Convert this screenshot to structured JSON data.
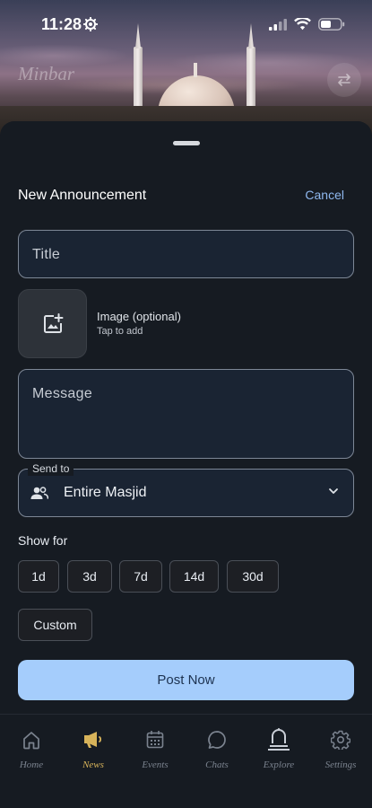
{
  "status_bar": {
    "time": "11:28"
  },
  "header": {
    "brand": "Minbar"
  },
  "sheet": {
    "title": "New Announcement",
    "cancel_label": "Cancel",
    "title_placeholder": "Title",
    "image": {
      "label": "Image (optional)",
      "hint": "Tap to add"
    },
    "message_placeholder": "Message",
    "send_to": {
      "legend": "Send to",
      "value": "Entire Masjid"
    },
    "show_for": {
      "label": "Show for",
      "options": [
        "1d",
        "3d",
        "7d",
        "14d",
        "30d",
        "Custom"
      ]
    },
    "post_label": "Post Now"
  },
  "tabs": [
    {
      "label": "Home",
      "icon": "home-icon"
    },
    {
      "label": "News",
      "icon": "megaphone-icon",
      "active": true
    },
    {
      "label": "Events",
      "icon": "calendar-icon"
    },
    {
      "label": "Chats",
      "icon": "chat-bubble-icon"
    },
    {
      "label": "Explore",
      "icon": "mosque-icon"
    },
    {
      "label": "Settings",
      "icon": "gear-icon"
    }
  ],
  "colors": {
    "accent_active_tab": "#d7b35a",
    "link": "#8fb8ef",
    "primary_button": "#a5cdfc",
    "background": "#161b22"
  }
}
